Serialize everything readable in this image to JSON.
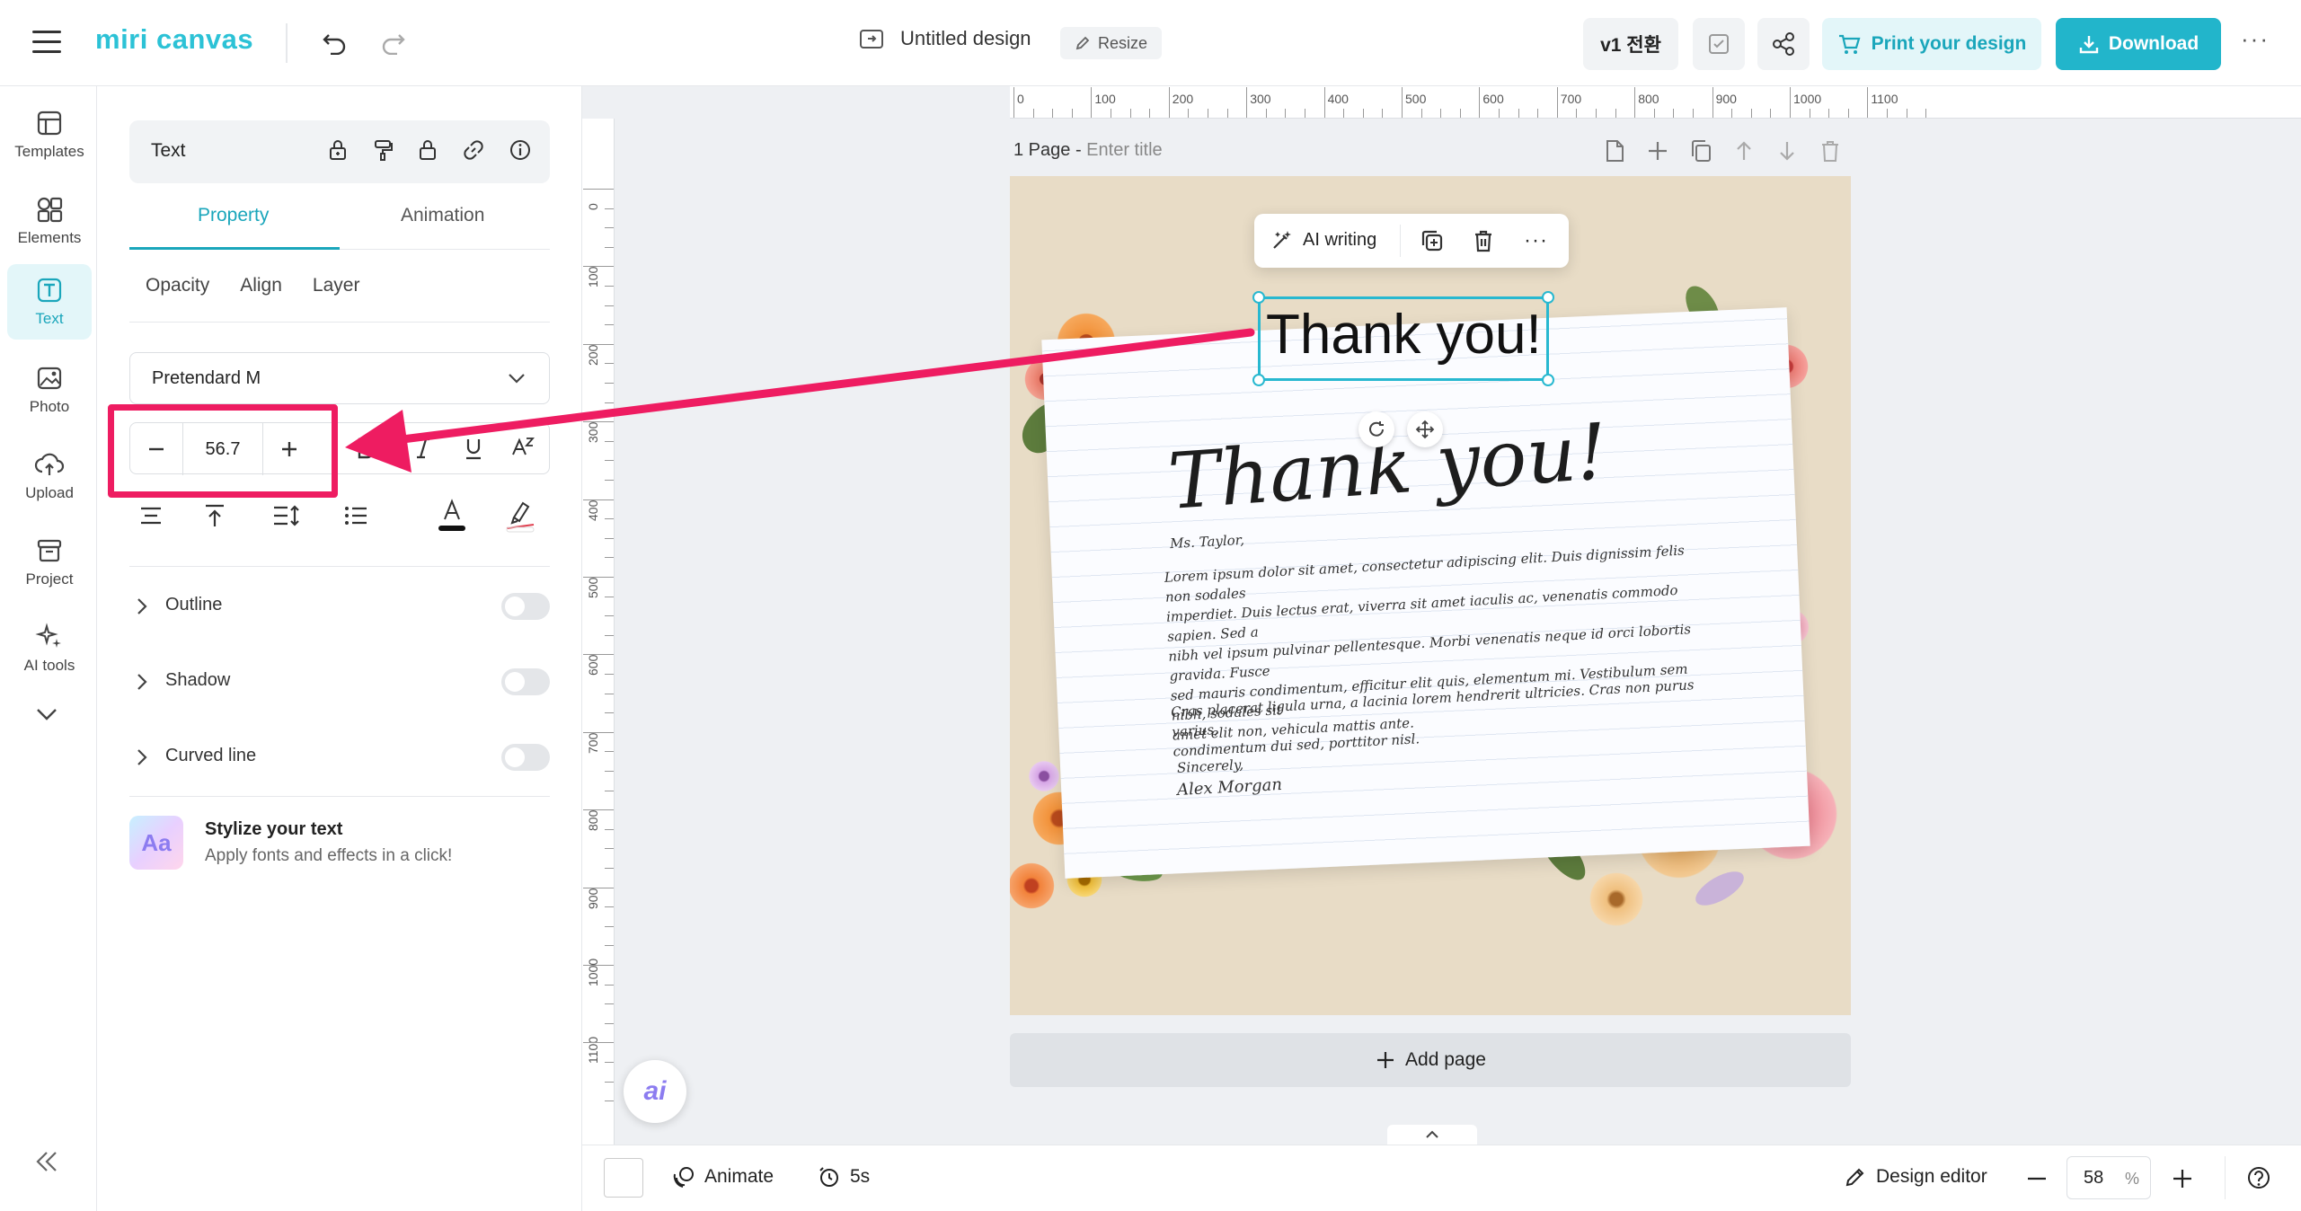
{
  "app": {
    "logo": "miri canvas",
    "design_title": "Untitled design",
    "resize_label": "Resize",
    "v1_label": "v1 전환",
    "print_label": "Print your design",
    "download_label": "Download"
  },
  "rail": {
    "items": [
      {
        "label": "Templates",
        "icon": "templates-icon"
      },
      {
        "label": "Elements",
        "icon": "elements-icon"
      },
      {
        "label": "Text",
        "icon": "text-icon",
        "active": true
      },
      {
        "label": "Photo",
        "icon": "photo-icon"
      },
      {
        "label": "Upload",
        "icon": "upload-icon"
      },
      {
        "label": "Project",
        "icon": "project-icon"
      },
      {
        "label": "AI tools",
        "icon": "ai-tools-icon"
      }
    ]
  },
  "panel": {
    "header_label": "Text",
    "tabs": [
      "Property",
      "Animation"
    ],
    "subtabs": [
      "Opacity",
      "Align",
      "Layer"
    ],
    "font_name": "Pretendard M",
    "font_size": "56.7",
    "toggles": [
      {
        "label": "Outline"
      },
      {
        "label": "Shadow"
      },
      {
        "label": "Curved line"
      }
    ],
    "stylize": {
      "thumb": "Aa",
      "title": "Stylize your text",
      "subtitle": "Apply fonts and effects in a click!"
    }
  },
  "ruler": {
    "top": [
      "0",
      "100",
      "200",
      "300",
      "400",
      "500",
      "600",
      "700",
      "800",
      "900",
      "1000",
      "1100"
    ],
    "left": [
      "0",
      "100",
      "200",
      "300",
      "400",
      "500",
      "600",
      "700",
      "800",
      "900",
      "1000",
      "1100"
    ]
  },
  "page": {
    "label": "1 Page - ",
    "title_placeholder": "Enter title",
    "ai_writing_label": "AI writing",
    "selected_text": "Thank you!",
    "hand_title": "Thank you!",
    "letter": {
      "salutation": "Ms. Taylor,",
      "p1": [
        "Lorem ipsum dolor sit amet, consectetur adipiscing elit. Duis dignissim felis non sodales",
        "imperdiet. Duis lectus erat, viverra sit amet iaculis ac, venenatis commodo sapien. Sed a",
        "nibh vel ipsum pulvinar pellentesque. Morbi venenatis neque id orci lobortis gravida. Fusce",
        "sed mauris condimentum, efficitur elit quis, elementum mi. Vestibulum sem nibh, sodales sit",
        "amet elit non, vehicula mattis ante."
      ],
      "p2": [
        "Cras placerat ligula urna, a lacinia lorem hendrerit ultricies. Cras non purus varius,",
        "condimentum dui sed, porttitor nisl."
      ],
      "closing": "Sincerely,",
      "signature": "Alex Morgan"
    },
    "add_page_label": "Add page",
    "ai_fab": "ai"
  },
  "bottom": {
    "animate_label": "Animate",
    "duration_label": "5s",
    "design_editor_label": "Design editor",
    "zoom_value": "58",
    "zoom_unit": "%"
  },
  "colors": {
    "accent": "#22b5cb",
    "annotation": "#ee1c61",
    "canvas_bg": "#e8dcc6"
  }
}
